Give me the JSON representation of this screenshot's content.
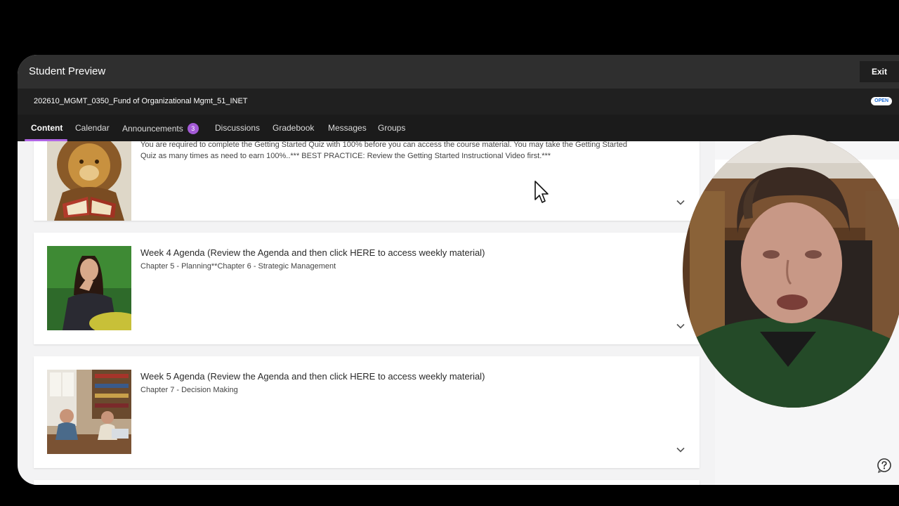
{
  "preview": {
    "title": "Student Preview",
    "exit_label": "Exit"
  },
  "course": {
    "title": "202610_MGMT_0350_Fund of Organizational Mgmt_51_INET",
    "status_badge": "OPEN"
  },
  "tabs": [
    {
      "label": "Content",
      "active": true
    },
    {
      "label": "Calendar"
    },
    {
      "label": "Announcements",
      "badge": "3"
    },
    {
      "label": "Discussions"
    },
    {
      "label": "Gradebook"
    },
    {
      "label": "Messages"
    },
    {
      "label": "Groups"
    }
  ],
  "cards": [
    {
      "subtitle_line1": "You are required to complete the Getting Started Quiz with 100% before you can access the course material. You may take the Getting Started",
      "subtitle_line2": "Quiz as many times as need to earn 100%..*** BEST PRACTICE: Review the Getting Started Instructional Video first.***",
      "thumbnail": "lion-reading-book-image"
    },
    {
      "title": "Week 4 Agenda (Review the Agenda and then click HERE to access weekly material)",
      "subtitle": "Chapter 5 - Planning**Chapter 6 - Strategic Management",
      "thumbnail": "woman-thinking-image"
    },
    {
      "title": "Week 5 Agenda (Review the Agenda and then click HERE to access weekly material)",
      "subtitle": "Chapter 7 - Decision Making",
      "thumbnail": "office-meeting-image"
    }
  ],
  "icons": {
    "expand": "chevron-down-icon",
    "help": "help-question-icon",
    "cursor": "mouse-pointer-icon"
  },
  "colors": {
    "accent": "#b066e5",
    "badge": "#a35ad6",
    "link_blue": "#1f6fd8"
  }
}
